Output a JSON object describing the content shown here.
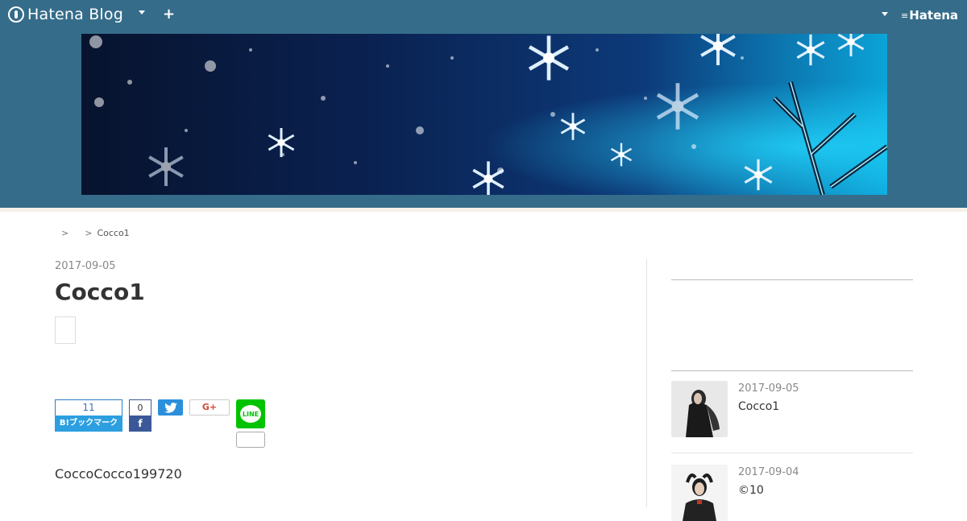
{
  "topbar": {
    "brand": "Hatena Blog",
    "right_logo": "Hatena",
    "icons": [
      "hatena-blog-icon",
      "chevron-down-icon",
      "plus-icon",
      "chevron-down-icon",
      "hatena-logo-icon"
    ]
  },
  "colors": {
    "header_bg": "#356c8a",
    "bookmark_blue": "#2c9fe0",
    "facebook_blue": "#3b5998",
    "twitter_blue": "#2b8fdb",
    "line_green": "#00c300"
  },
  "breadcrumb": {
    "sep1": ">",
    "sep2": ">",
    "current": "Cocco1"
  },
  "entry": {
    "date": "2017-09-05",
    "title": "Cocco1",
    "body": "CoccoCocco199720"
  },
  "share": {
    "hatena_count": "11",
    "hatena_label": "B!ブックマーク",
    "facebook_count": "0",
    "facebook_icon": "f",
    "google_plus_label": "G+",
    "line_label": "LINE"
  },
  "sidebar": {
    "entries": [
      {
        "date": "2017-09-05",
        "title": "Cocco1"
      },
      {
        "date": "2017-09-04",
        "title": "©10"
      }
    ]
  }
}
